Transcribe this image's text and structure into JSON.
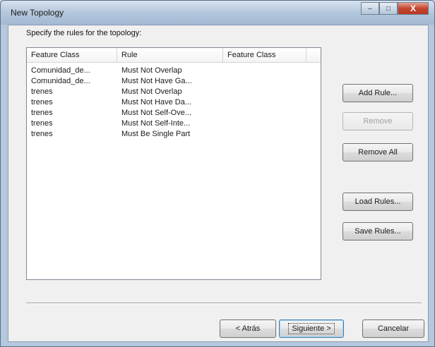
{
  "window": {
    "title": "New Topology",
    "minimize_glyph": "–",
    "maximize_glyph": "□",
    "close_glyph": "X"
  },
  "instructions": "Specify the rules for the topology:",
  "table": {
    "columns": [
      "Feature Class",
      "Rule",
      "Feature Class"
    ],
    "rows": [
      [
        "Comunidad_de...",
        "Must Not Overlap",
        ""
      ],
      [
        "Comunidad_de...",
        "Must Not Have Ga...",
        ""
      ],
      [
        "trenes",
        "Must Not Overlap",
        ""
      ],
      [
        "trenes",
        "Must Not Have Da...",
        ""
      ],
      [
        "trenes",
        "Must Not Self-Ove...",
        ""
      ],
      [
        "trenes",
        "Must Not Self-Inte...",
        ""
      ],
      [
        "trenes",
        "Must Be Single Part",
        ""
      ]
    ]
  },
  "buttons": {
    "add_rule": "Add Rule...",
    "remove": "Remove",
    "remove_all": "Remove All",
    "load_rules": "Load Rules...",
    "save_rules": "Save Rules...",
    "back": "< Atrás",
    "next": "Siguiente >",
    "cancel": "Cancelar"
  },
  "colors": {
    "window_frame": "#b4c7dc",
    "client_background": "#f0f0f0",
    "close_button": "#c4452d"
  }
}
